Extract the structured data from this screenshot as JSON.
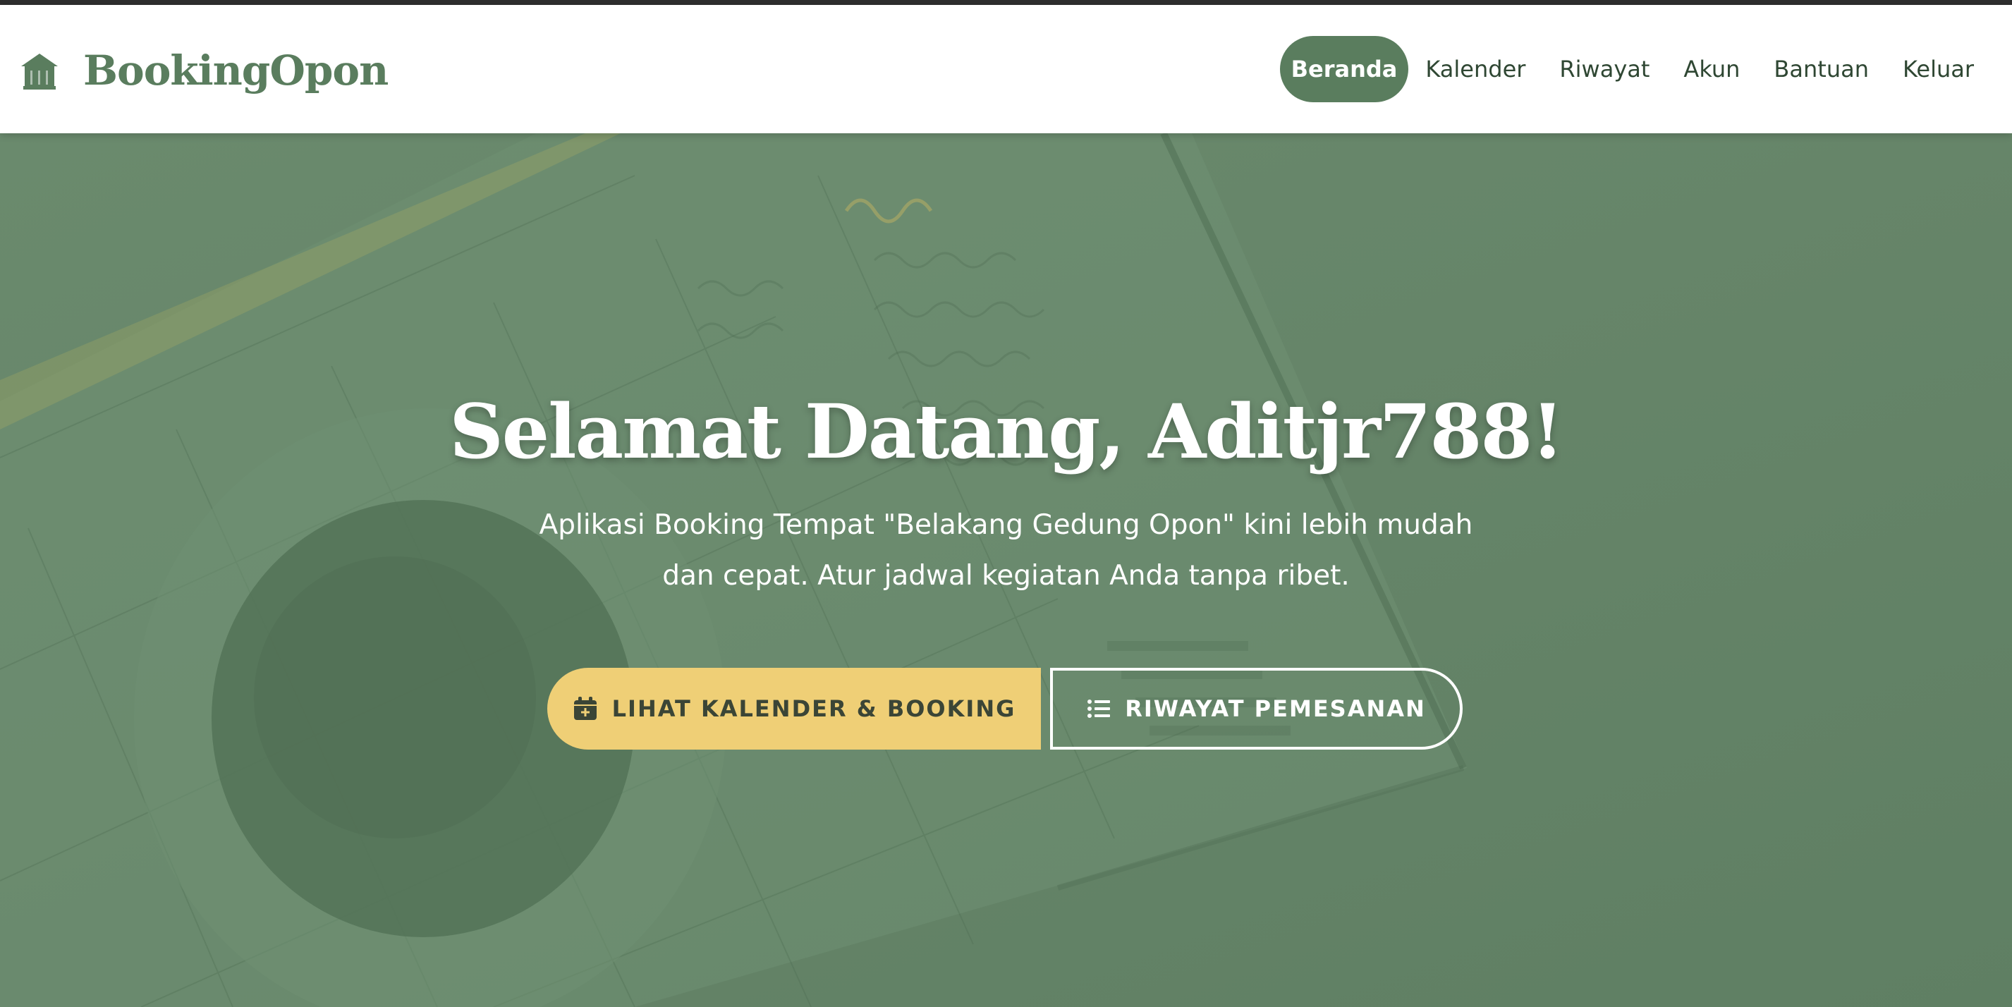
{
  "brand": {
    "name": "BookingOpon",
    "icon": "home-icon"
  },
  "nav": {
    "items": [
      {
        "label": "Beranda",
        "active": true
      },
      {
        "label": "Kalender",
        "active": false
      },
      {
        "label": "Riwayat",
        "active": false
      },
      {
        "label": "Akun",
        "active": false
      },
      {
        "label": "Bantuan",
        "active": false
      },
      {
        "label": "Keluar",
        "active": false
      }
    ]
  },
  "hero": {
    "title": "Selamat Datang, Aditjr788!",
    "subtitle_line1": "Aplikasi Booking Tempat \"Belakang Gedung Opon\" kini lebih mudah",
    "subtitle_line2": "dan cepat. Atur jadwal kegiatan Anda tanpa ribet.",
    "primary_button": {
      "label": "LIHAT KALENDER & BOOKING",
      "icon": "calendar-plus-icon"
    },
    "secondary_button": {
      "label": "RIWAYAT PEMESANAN",
      "icon": "list-icon"
    }
  },
  "colors": {
    "brand_green": "#5a7d5e",
    "hero_overlay": "#63836a",
    "accent_yellow": "#efcf76",
    "white": "#ffffff"
  }
}
